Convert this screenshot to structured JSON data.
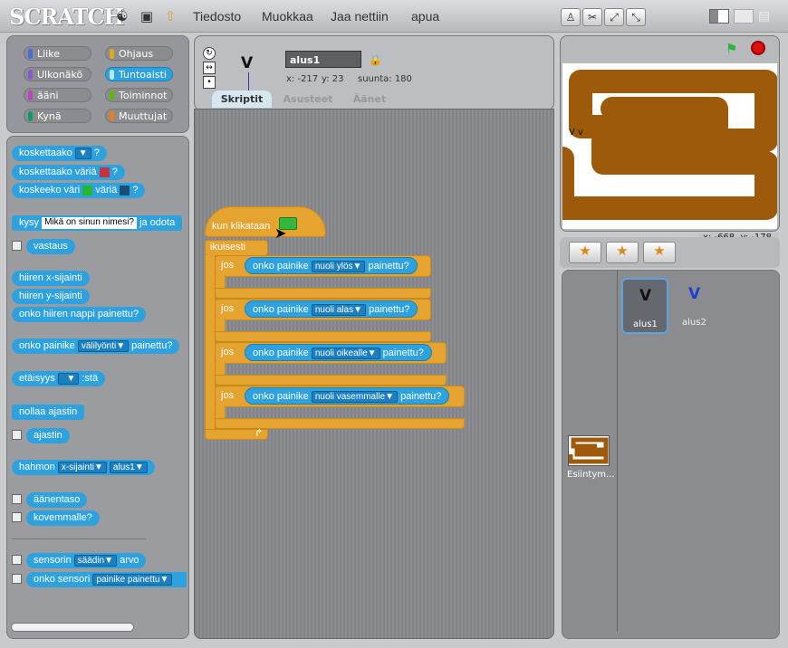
{
  "app": {
    "logo": "SCRATCH"
  },
  "menu": [
    "Tiedosto",
    "Muokkaa",
    "Jaa nettiin",
    "apua"
  ],
  "categories": [
    {
      "label": "Liike",
      "color": "#4a6cd4"
    },
    {
      "label": "Ohjaus",
      "color": "#e1a91a"
    },
    {
      "label": "Ulkonäkö",
      "color": "#8a55d7"
    },
    {
      "label": "Tuntoaisti",
      "color": "#2ca5e2"
    },
    {
      "label": "ääni",
      "color": "#bb42c3"
    },
    {
      "label": "Toiminnot",
      "color": "#5cb712"
    },
    {
      "label": "Kynä",
      "color": "#0e9a6c"
    },
    {
      "label": "Muuttujat",
      "color": "#ee7d16"
    }
  ],
  "palette": {
    "touching": "koskettaako",
    "touching_color": "koskettaako väriä",
    "color_touching": "koskeeko väri",
    "color_touching2": "väriä",
    "ask": "kysy",
    "ask_default": "Mikä on sinun nimesi?",
    "ask_wait": "ja odota",
    "answer": "vastaus",
    "mouse_x": "hiiren x-sijainti",
    "mouse_y": "hiiren y-sijainti",
    "mouse_down": "onko hiiren nappi painettu?",
    "key_pressed": "onko painike",
    "key_space": "välilyönti",
    "key_pressed2": "painettu?",
    "distance": "etäisyys",
    "distance_suffix": ":stä",
    "reset_timer": "nollaa ajastin",
    "timer": "ajastin",
    "of": "hahmon",
    "of_attr": "x-sijainti",
    "of_sprite": "alus1",
    "loudness": "äänentaso",
    "loud": "kovemmalle?",
    "sensor": "sensorin",
    "sensor_val": "säädin",
    "sensor_val2": "arvo",
    "sensor_pressed": "onko sensori",
    "sensor_pressed_val": "painike painettu",
    "q": "?"
  },
  "sprite": {
    "name": "alus1",
    "costume": "V",
    "x": "x:  -217",
    "y": "y:  23",
    "direction": "suunta:  180"
  },
  "tabs": [
    "Skriptit",
    "Asusteet",
    "Äänet"
  ],
  "script": {
    "hat": "kun klikataan",
    "forever": "ikuisesti",
    "if": "jos",
    "cond_pre": "onko painike",
    "cond_post": "painettu?",
    "keys": [
      "nuoli ylös",
      "nuoli alas",
      "nuoli oikealle",
      "nuoli vasemmalle"
    ]
  },
  "stage": {
    "mouse_x": "x: -668",
    "mouse_y": "y: -178",
    "sprite_label": "V v"
  },
  "sprites": [
    {
      "name": "alus1",
      "costume": "V"
    },
    {
      "name": "alus2",
      "costume": "V"
    }
  ],
  "stage_thumb": {
    "name": "Esiintym..."
  }
}
